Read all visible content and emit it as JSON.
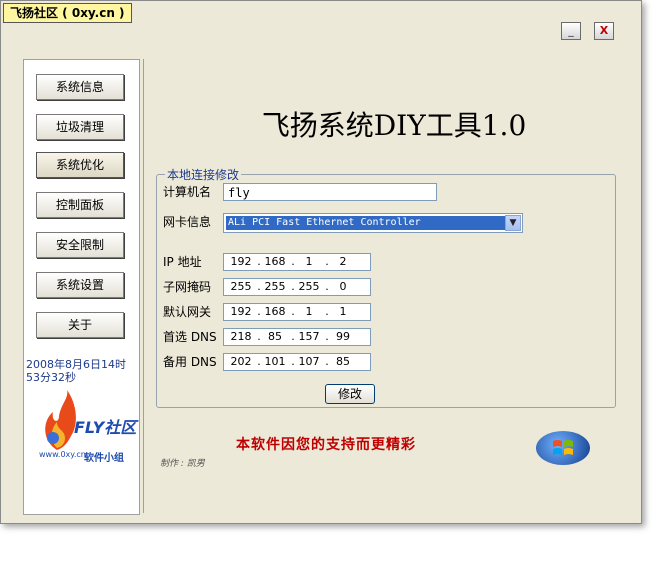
{
  "window": {
    "title": "飞扬社区 ( 0xy.cn )",
    "minimize_label": "_",
    "close_label": "X"
  },
  "sidebar": {
    "items": [
      {
        "label": "系统信息"
      },
      {
        "label": "垃圾清理"
      },
      {
        "label": "系统优化",
        "active": true
      },
      {
        "label": "控制面板"
      },
      {
        "label": "安全限制"
      },
      {
        "label": "系统设置"
      },
      {
        "label": "关于"
      }
    ],
    "datetime": "2008年8月6日14时53分32秒",
    "logo": {
      "name": "FLY社区",
      "url": "www.0xy.cn",
      "subtitle": "软件小组"
    }
  },
  "main": {
    "app_title": "飞扬系统DIY工具1.0",
    "group_title": "本地连接修改",
    "computer_name_label": "计算机名",
    "computer_name_value": "fly",
    "nic_label": "网卡信息",
    "nic_value": "ALi PCI Fast Ethernet Controller",
    "ip_fields": [
      {
        "label": "IP  地址",
        "octets": [
          "192",
          "168",
          "1",
          "2"
        ]
      },
      {
        "label": "子网掩码",
        "octets": [
          "255",
          "255",
          "255",
          "0"
        ]
      },
      {
        "label": "默认网关",
        "octets": [
          "192",
          "168",
          "1",
          "1"
        ]
      },
      {
        "label": "首选 DNS",
        "octets": [
          "218",
          "85",
          "157",
          "99"
        ]
      },
      {
        "label": "备用 DNS",
        "octets": [
          "202",
          "101",
          "107",
          "85"
        ]
      }
    ],
    "modify_label": "修改",
    "banner_text": "本软件因您的支持而更精彩",
    "maker_text": "制作 : 凯男"
  },
  "colors": {
    "accent": "#316ac5",
    "banner": "#c00000",
    "label_blue": "#1e3a8a"
  }
}
